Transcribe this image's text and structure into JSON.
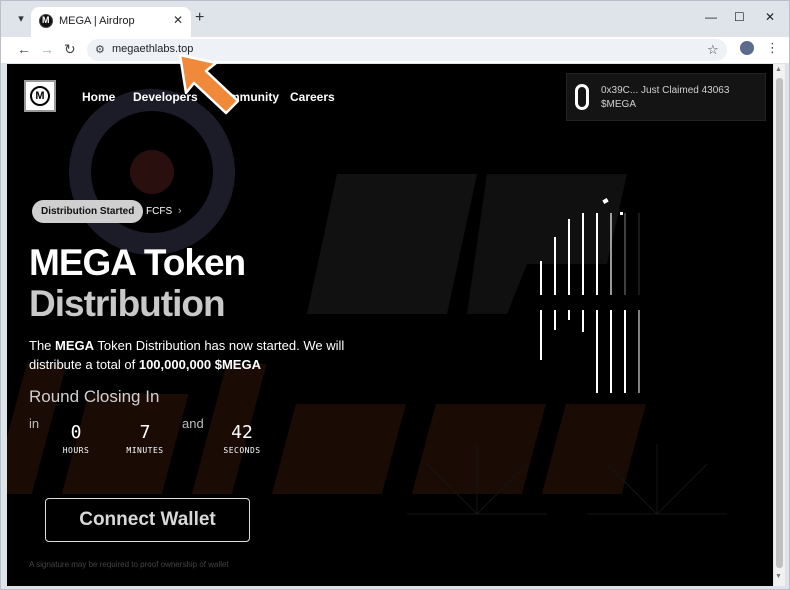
{
  "browser": {
    "tab_title": "MEGA | Airdrop",
    "url": "megaethlabs.top",
    "icons": {
      "tab_menu": "▾",
      "tab_close": "✕",
      "new_tab": "+",
      "minimize": "—",
      "maximize": "☐",
      "close": "✕",
      "back": "←",
      "forward": "→",
      "reload": "↻",
      "site_info": "⚙",
      "bookmark": "☆",
      "menu": "⋮"
    }
  },
  "site": {
    "logo_letter": "M",
    "nav": {
      "home": "Home",
      "developers": "Developers",
      "community": "Community",
      "careers": "Careers"
    },
    "claim_notice": "0x39C... Just Claimed 43063 $MEGA",
    "badge": "Distribution Started",
    "fcfs": "FCFS",
    "fcfs_chevron": "›",
    "title_line1": "MEGA Token",
    "title_line2": "Distribution",
    "desc": {
      "p1": "The ",
      "b1": "MEGA",
      "p2": " Token Distribution has now started. We will distribute a total of ",
      "b2": "100,000,000 $MEGA"
    },
    "round_label": "Round Closing In",
    "in_label": "in",
    "and_label": "and",
    "countdown": {
      "hours": "0",
      "hours_label": "HOURS",
      "minutes": "7",
      "minutes_label": "MINUTES",
      "seconds": "42",
      "seconds_label": "SECONDS"
    },
    "connect_button": "Connect Wallet",
    "signature_note": "A signature may be required to proof ownership of wallet"
  },
  "colors": {
    "page_bg": "#000000",
    "arrow": "#f08a3a",
    "watermark": "#2a1208"
  }
}
